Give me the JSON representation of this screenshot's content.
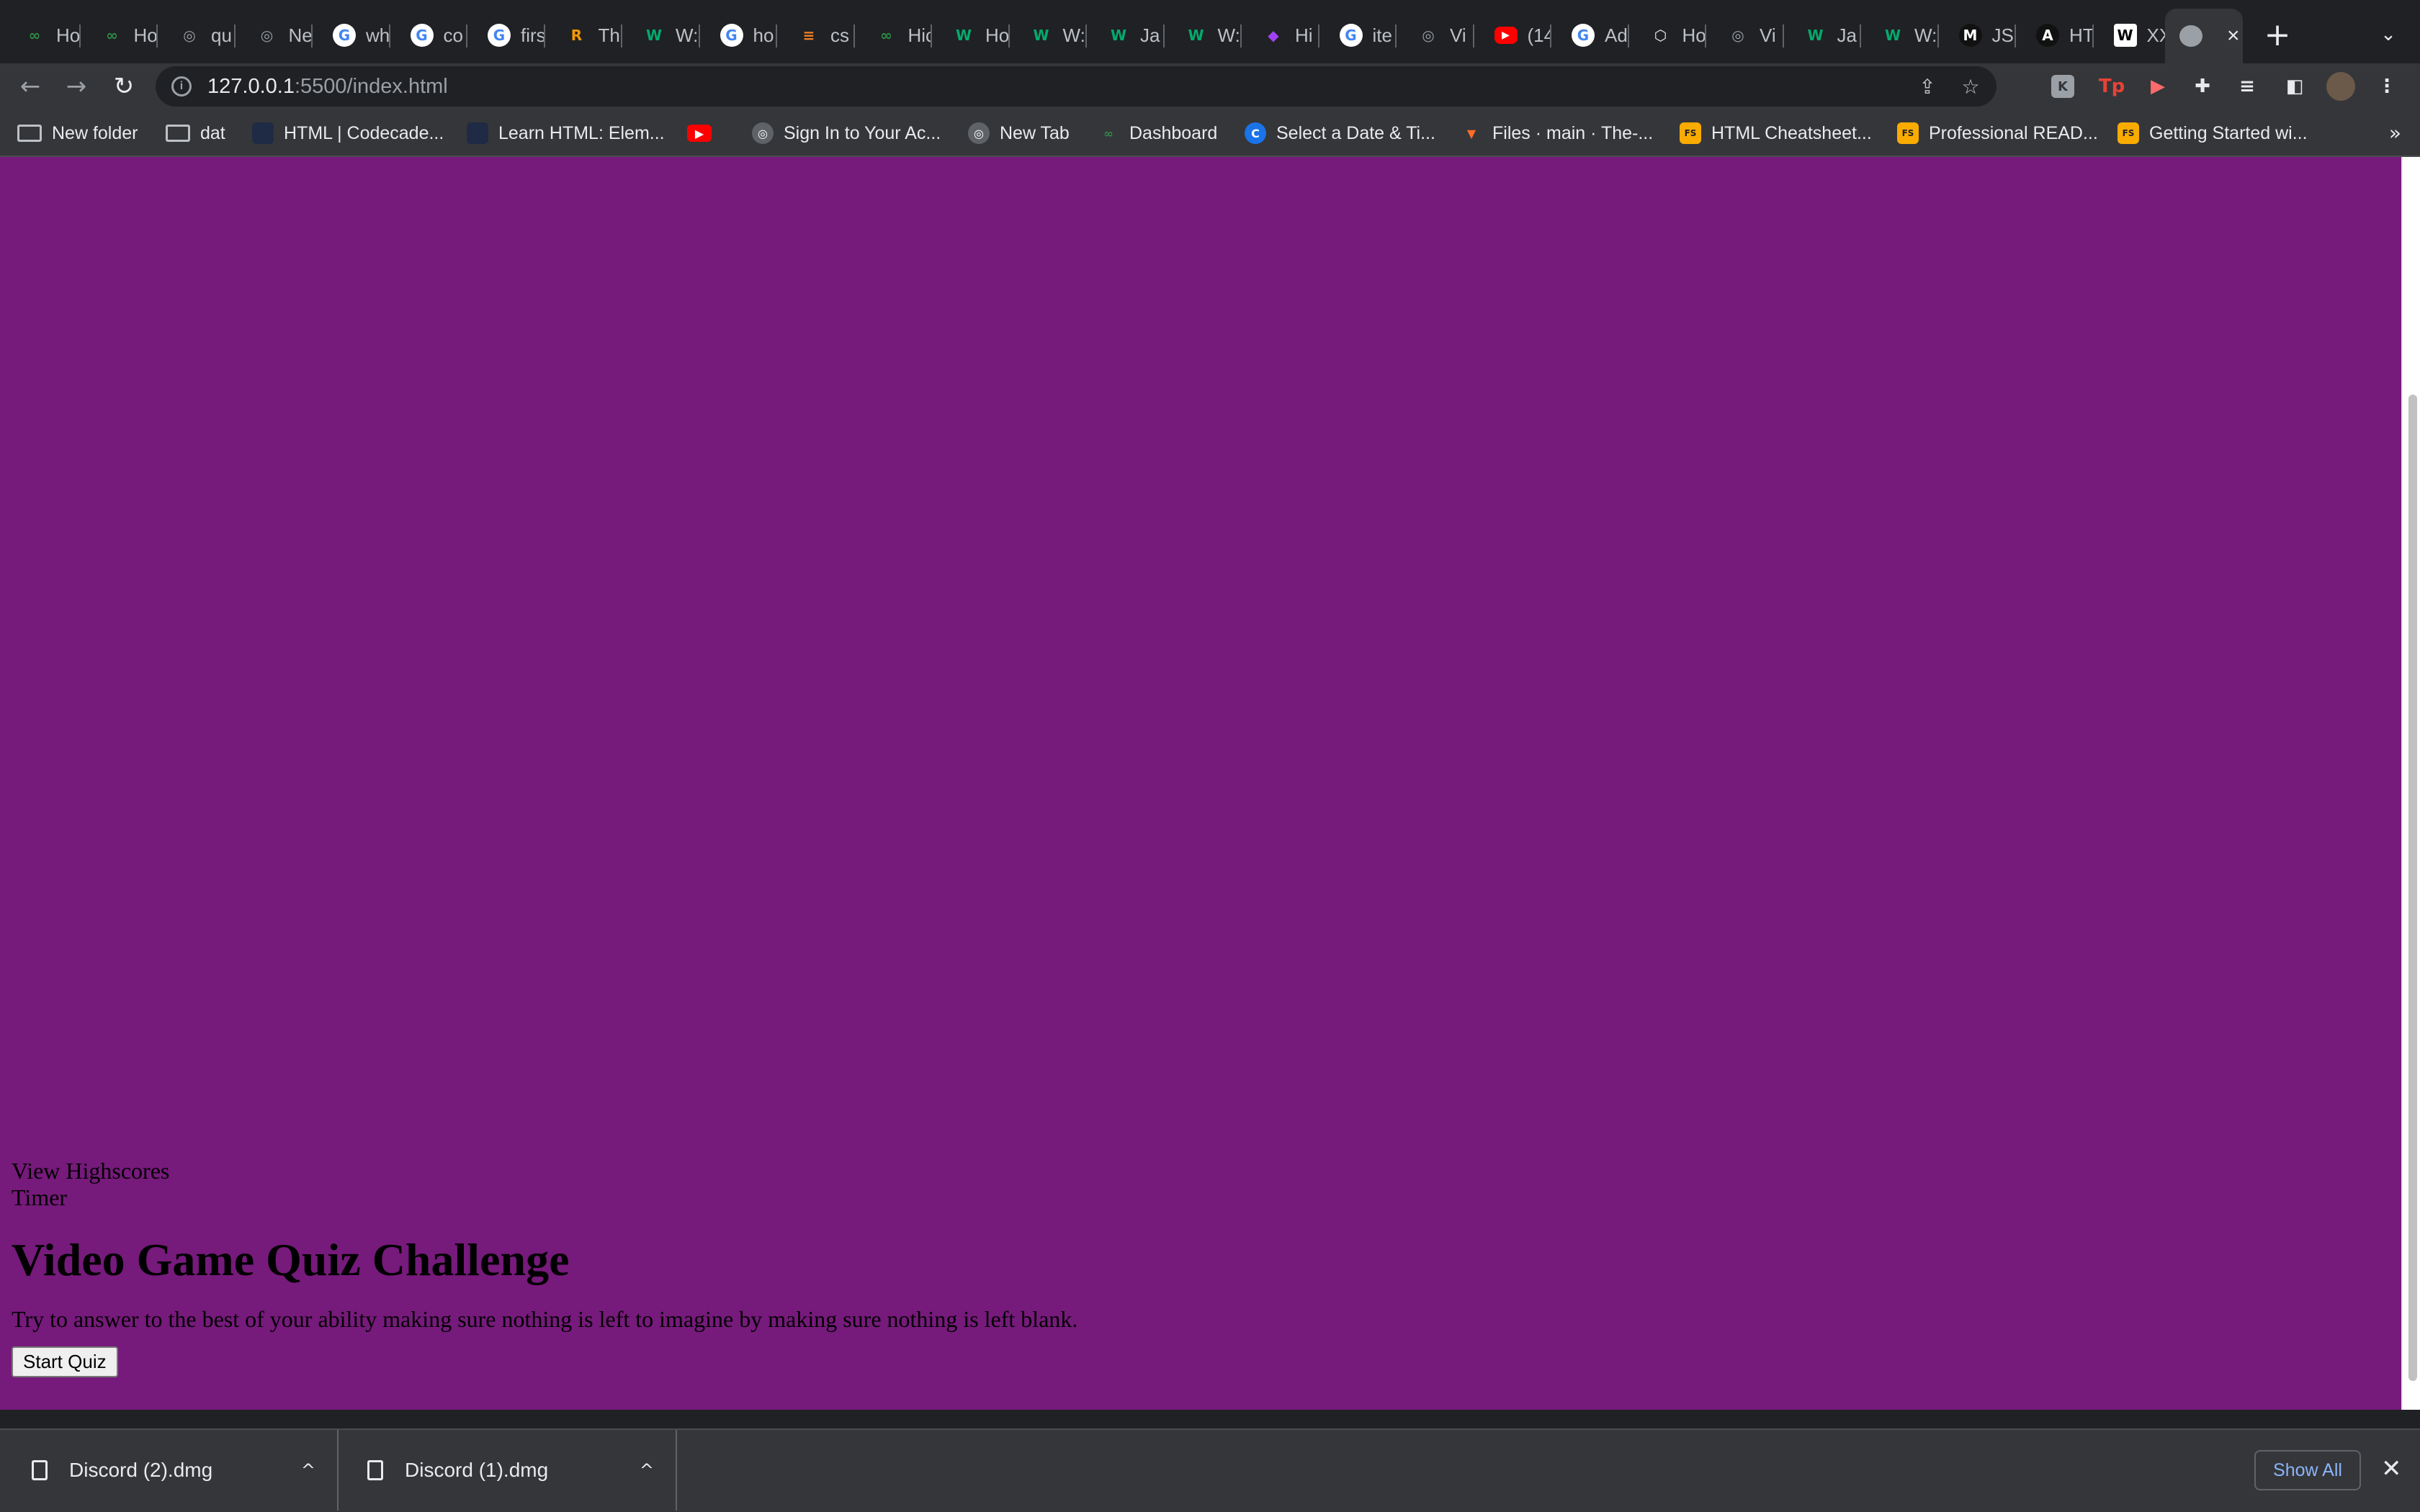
{
  "browser": {
    "tabs": [
      {
        "label": "Ho",
        "icon": "leaf-icon",
        "color": "#2f8d46",
        "glyph": "∞"
      },
      {
        "label": "Ho",
        "icon": "leaf-icon",
        "color": "#2f8d46",
        "glyph": "∞"
      },
      {
        "label": "qu",
        "icon": "globe-icon",
        "color": "#9aa0a6",
        "glyph": "◎"
      },
      {
        "label": "Ne",
        "icon": "chrome-icon",
        "color": "#9aa0a6",
        "glyph": "◎"
      },
      {
        "label": "wh",
        "icon": "google-icon",
        "color": "#4285f4",
        "glyph": "G"
      },
      {
        "label": "co",
        "icon": "google-icon",
        "color": "#4285f4",
        "glyph": "G"
      },
      {
        "label": "firs",
        "icon": "google-icon",
        "color": "#4285f4",
        "glyph": "G"
      },
      {
        "label": "Th",
        "icon": "r-icon",
        "color": "#f29900",
        "glyph": "R"
      },
      {
        "label": "W:",
        "icon": "w3-icon",
        "color": "#04aa6d",
        "glyph": "W"
      },
      {
        "label": "ho",
        "icon": "google-icon",
        "color": "#4285f4",
        "glyph": "G"
      },
      {
        "label": "cs",
        "icon": "stackoverflow-icon",
        "color": "#f48024",
        "glyph": "≡"
      },
      {
        "label": "Hic",
        "icon": "leaf-icon",
        "color": "#2f8d46",
        "glyph": "∞"
      },
      {
        "label": "Ho",
        "icon": "w3-icon",
        "color": "#04aa6d",
        "glyph": "W"
      },
      {
        "label": "W:",
        "icon": "w3-icon",
        "color": "#04aa6d",
        "glyph": "W"
      },
      {
        "label": "Ja",
        "icon": "w3-icon",
        "color": "#04aa6d",
        "glyph": "W"
      },
      {
        "label": "W:",
        "icon": "w3-icon",
        "color": "#04aa6d",
        "glyph": "W"
      },
      {
        "label": "Hi",
        "icon": "colorful-icon",
        "color": "#a142f4",
        "glyph": "◆"
      },
      {
        "label": "ite",
        "icon": "google-icon",
        "color": "#4285f4",
        "glyph": "G"
      },
      {
        "label": "Vi",
        "icon": "globe-icon",
        "color": "#9aa0a6",
        "glyph": "◎"
      },
      {
        "label": "(14",
        "icon": "youtube-icon",
        "color": "#ff0000",
        "glyph": "▶"
      },
      {
        "label": "Ad",
        "icon": "google-icon",
        "color": "#4285f4",
        "glyph": "G"
      },
      {
        "label": "Ho",
        "icon": "hex-icon",
        "color": "#e8eaed",
        "glyph": "⬡"
      },
      {
        "label": "Vi",
        "icon": "globe-icon",
        "color": "#9aa0a6",
        "glyph": "◎"
      },
      {
        "label": "Ja",
        "icon": "w3-icon",
        "color": "#04aa6d",
        "glyph": "W"
      },
      {
        "label": "W:",
        "icon": "w3-icon",
        "color": "#04aa6d",
        "glyph": "W"
      },
      {
        "label": "JS",
        "icon": "mdn-icon",
        "color": "#000000",
        "glyph": "M"
      },
      {
        "label": "HT",
        "icon": "a-icon",
        "color": "#000000",
        "glyph": "A"
      },
      {
        "label": "XX",
        "icon": "wikipedia-icon",
        "color": "#ffffff",
        "glyph": "W"
      }
    ],
    "active_tab": {
      "label": "",
      "icon": "globe-icon"
    },
    "new_tab_glyph": "+",
    "tab_search_glyph": "⌄",
    "url_host": "127.0.0.1",
    "url_rest": ":5500/index.html",
    "bookmarks": [
      {
        "label": "New folder",
        "icon": "folder-icon"
      },
      {
        "label": "dat",
        "icon": "folder-icon"
      },
      {
        "label": "HTML | Codecade...",
        "icon": "codecademy-icon"
      },
      {
        "label": "Learn HTML: Elem...",
        "icon": "codecademy-icon"
      },
      {
        "label": "",
        "icon": "youtube-icon"
      },
      {
        "label": "Sign In to Your Ac...",
        "icon": "globe-icon"
      },
      {
        "label": "New Tab",
        "icon": "globe-icon"
      },
      {
        "label": "Dashboard",
        "icon": "leaf-icon"
      },
      {
        "label": "Select a Date & Ti...",
        "icon": "calendly-icon"
      },
      {
        "label": "Files · main · The-...",
        "icon": "gitlab-icon"
      },
      {
        "label": "HTML Cheatsheet...",
        "icon": "fs-icon"
      },
      {
        "label": "Professional READ...",
        "icon": "fs-icon"
      },
      {
        "label": "Getting Started wi...",
        "icon": "fs-icon"
      }
    ],
    "bookmarks_more": "»"
  },
  "page": {
    "view_highscores": "View Highscores",
    "timer": "Timer",
    "title": "Video Game Quiz Challenge",
    "description": "Try to answer to the best of your ability making sure nothing is left to imagine by making sure nothing is left blank.",
    "start_button": "Start Quiz",
    "background_color": "#761a7b"
  },
  "downloads": {
    "items": [
      {
        "name": "Discord (2).dmg"
      },
      {
        "name": "Discord (1).dmg"
      }
    ],
    "show_all": "Show All",
    "close_glyph": "✕"
  }
}
